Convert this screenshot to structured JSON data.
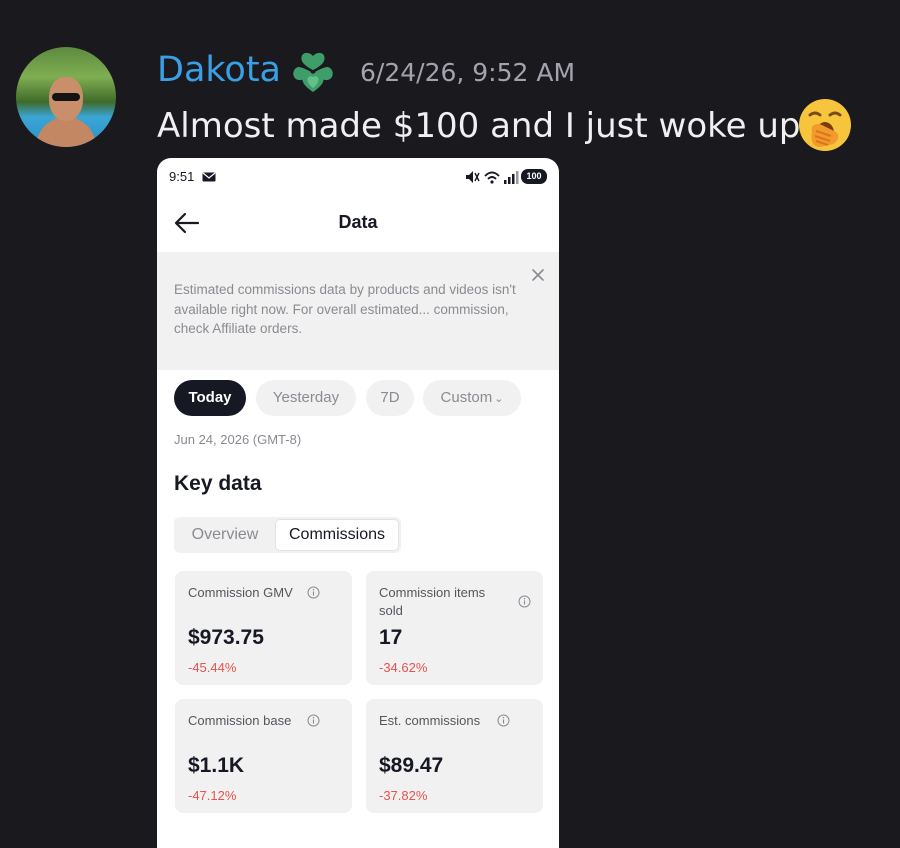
{
  "message": {
    "author": "Dakota",
    "timestamp": "6/24/26, 9:52 AM",
    "text": "Almost made $100 and I just woke up",
    "avatar_icon": "user-avatar-photo",
    "badge_icon": "green-heart-badge-icon",
    "emoji_icon": "yawning-face-emoji",
    "colors": {
      "author": "#3aa0e6",
      "background": "#1a191e",
      "text": "#f0f0f2",
      "timestamp": "#a3a3ad"
    }
  },
  "screenshot": {
    "status_bar": {
      "time": "9:51",
      "battery": "100"
    },
    "nav": {
      "title": "Data",
      "back_icon": "back-arrow-icon"
    },
    "notice": {
      "text": "Estimated commissions data by products and videos isn't available right now. For overall estimated... commission, check Affiliate orders.",
      "close_icon": "close-icon"
    },
    "date_filters": [
      {
        "label": "Today",
        "active": true
      },
      {
        "label": "Yesterday",
        "active": false
      },
      {
        "label": "7D",
        "active": false
      },
      {
        "label": "Custom",
        "active": false
      }
    ],
    "custom_chevron": "⌄",
    "date_label": "Jun 24, 2026 (GMT-8)",
    "section_title": "Key data",
    "tabs": [
      {
        "label": "Overview",
        "active": false
      },
      {
        "label": "Commissions",
        "active": true
      }
    ],
    "cards": [
      {
        "label": "Commission GMV",
        "value": "$973.75",
        "delta": "-45.44%"
      },
      {
        "label": "Commission items sold",
        "value": "17",
        "delta": "-34.62%"
      },
      {
        "label": "Commission base",
        "value": "$1.1K",
        "delta": "-47.12%"
      },
      {
        "label": "Est. commissions",
        "value": "$89.47",
        "delta": "-37.82%"
      }
    ],
    "colors": {
      "negative": "#e8534e",
      "chip_active": "#161823",
      "muted": "#8a8b91",
      "card_bg": "#f1f1f2"
    }
  }
}
